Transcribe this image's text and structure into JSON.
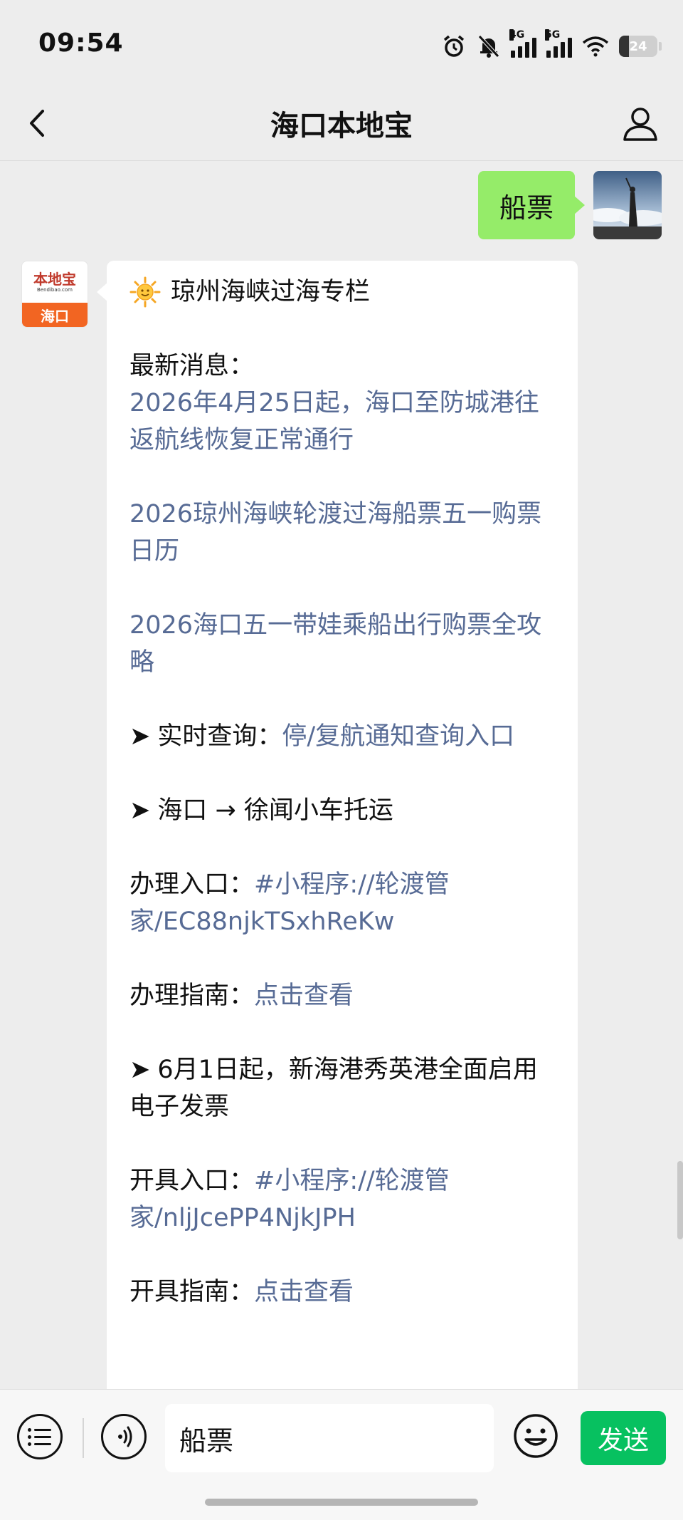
{
  "status_bar": {
    "time": "09:54",
    "signal_1_label": "4G",
    "signal_2_label": "5G",
    "battery_level": "24",
    "icons": [
      "alarm-icon",
      "mute-icon",
      "signal-4g-icon",
      "signal-5g-icon",
      "wifi-icon",
      "battery-icon"
    ]
  },
  "nav": {
    "title": "海口本地宝",
    "back_icon": "chevron-left-icon",
    "profile_icon": "person-icon"
  },
  "chat": {
    "sent_message": "船票",
    "sender_avatar": {
      "brand_text": "本地宝",
      "site_text": "Bendibao.com",
      "city_text": "海口"
    },
    "received": {
      "title": "琼州海峡过海专栏",
      "latest_label": "最新消息：",
      "links": [
        "2026年4月25日起，海口至防城港往返航线恢复正常通行",
        "2026琼州海峡轮渡过海船票五一购票日历",
        "2026海口五一带娃乘船出行购票全攻略"
      ],
      "arrow_symbol": "➤",
      "realtime_label": "实时查询：",
      "realtime_link": "停/复航通知查询入口",
      "transport_heading": "海口 → 徐闻小车托运",
      "handle_entry_label": "办理入口：",
      "handle_entry_link": "#小程序://轮渡管家/EC88njkTSxhReKw",
      "handle_guide_label": "办理指南：",
      "handle_guide_link": "点击查看",
      "invoice_heading": "6月1日起，新海港秀英港全面启用电子发票",
      "invoice_entry_label": "开具入口：",
      "invoice_entry_link": "#小程序://轮渡管家/nljJcePP4NjkJPH",
      "invoice_guide_label": "开具指南：",
      "invoice_guide_link": "点击查看"
    }
  },
  "input_bar": {
    "input_value": "船票",
    "send_label": "发送",
    "icons": [
      "menu-list-icon",
      "voice-icon",
      "emoji-icon"
    ]
  },
  "colors": {
    "sent_bubble": "#95ec69",
    "link": "#576b95",
    "send_button": "#07c160",
    "background": "#ededed",
    "brand_orange": "#f26522"
  }
}
